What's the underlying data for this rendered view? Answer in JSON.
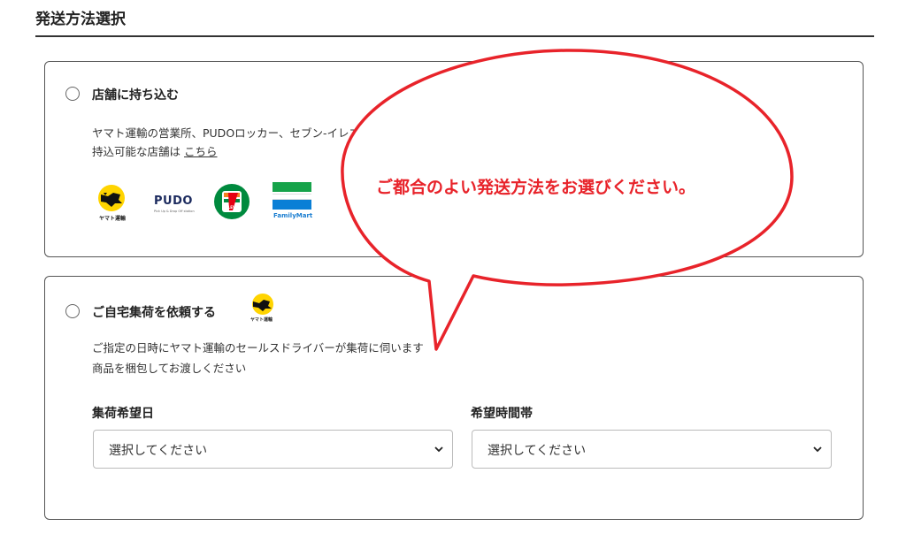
{
  "section_title": "発送方法選択",
  "options": [
    {
      "label": "店舗に持ち込む",
      "desc_line1": "ヤマト運輸の営業所、PUDOロッカー、セブン-イレブン、ファミリーマートから発送できます",
      "desc_line2_prefix": "持込可能な店舗は",
      "desc_line2_link": "こちら",
      "logos": [
        {
          "icon": "yamato-cat-icon",
          "caption": "ヤマト運輸"
        },
        {
          "icon": "pudo-logo",
          "text": "PUDO",
          "sub": "Pick Up & Drop Off station"
        },
        {
          "icon": "seven-eleven-logo",
          "text": "7",
          "sub": "ELEVEN"
        },
        {
          "icon": "familymart-logo",
          "text": "FamilyMart"
        }
      ]
    },
    {
      "label": "ご自宅集荷を依頼する",
      "badge_caption": "ヤマト運輸",
      "desc_line1": "ご指定の日時にヤマト運輸のセールスドライバーが集荷に伺います",
      "desc_line2": "商品を梱包してお渡しください",
      "date_label": "集荷希望日",
      "date_value": "選択してください",
      "time_label": "希望時間帯",
      "time_value": "選択してください"
    }
  ],
  "callout": {
    "text": "ご都合のよい発送方法をお選びください。",
    "color": "#e8232a"
  },
  "colors": {
    "yamato_yellow": "#ffd400",
    "seven_green": "#008a3e",
    "seven_red": "#e60012",
    "seven_orange": "#f58220",
    "familymart_blue": "#0a7fd6",
    "familymart_green": "#16a34a"
  }
}
